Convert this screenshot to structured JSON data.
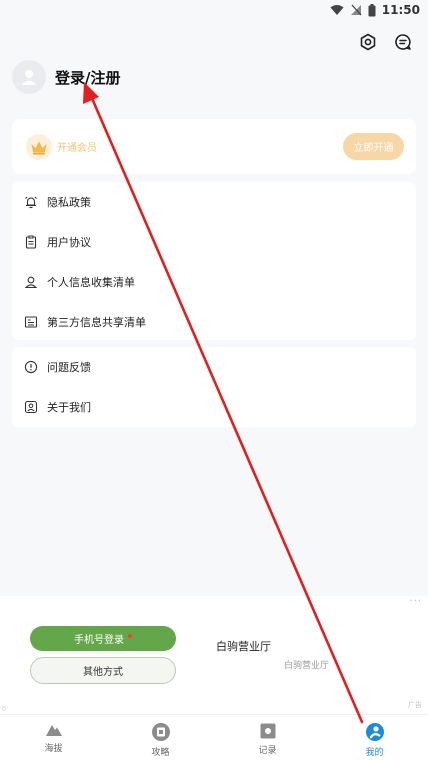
{
  "status_bar": {
    "time": "11:50"
  },
  "icons": {
    "wifi": "wifi-icon",
    "signal": "signal-off-icon",
    "battery": "battery-icon",
    "settings": "hexagon-gear-icon",
    "message": "message-icon",
    "avatar": "user-avatar-icon",
    "crown": "crown-icon"
  },
  "profile": {
    "login_title": "登录/注册"
  },
  "vip": {
    "label": "开通会员",
    "button": "立即开通"
  },
  "menu_group_1": [
    {
      "label": "隐私政策",
      "icon": "alarm-bell-icon"
    },
    {
      "label": "用户协议",
      "icon": "clipboard-icon"
    },
    {
      "label": "个人信息收集清单",
      "icon": "person-icon"
    },
    {
      "label": "第三方信息共享清单",
      "icon": "list-card-icon"
    }
  ],
  "menu_group_2": [
    {
      "label": "问题反馈",
      "icon": "exclamation-circle-icon"
    },
    {
      "label": "关于我们",
      "icon": "profile-card-icon"
    }
  ],
  "ad": {
    "more": "···",
    "phone_login": "手机号登录",
    "other_login": "其他方式",
    "title": "白驹营业厅",
    "subtitle": "白驹营业厅",
    "badge": "广告",
    "corner": "0"
  },
  "tabs": [
    {
      "label": "海拔",
      "icon": "mountain-icon"
    },
    {
      "label": "攻略",
      "icon": "guide-icon"
    },
    {
      "label": "记录",
      "icon": "record-icon"
    },
    {
      "label": "我的",
      "icon": "profile-tab-icon"
    }
  ],
  "colors": {
    "accent": "#1d8cd8",
    "vip_gold": "#f0c47c",
    "login_green": "#64a64a",
    "annotation_red": "#e02020"
  }
}
